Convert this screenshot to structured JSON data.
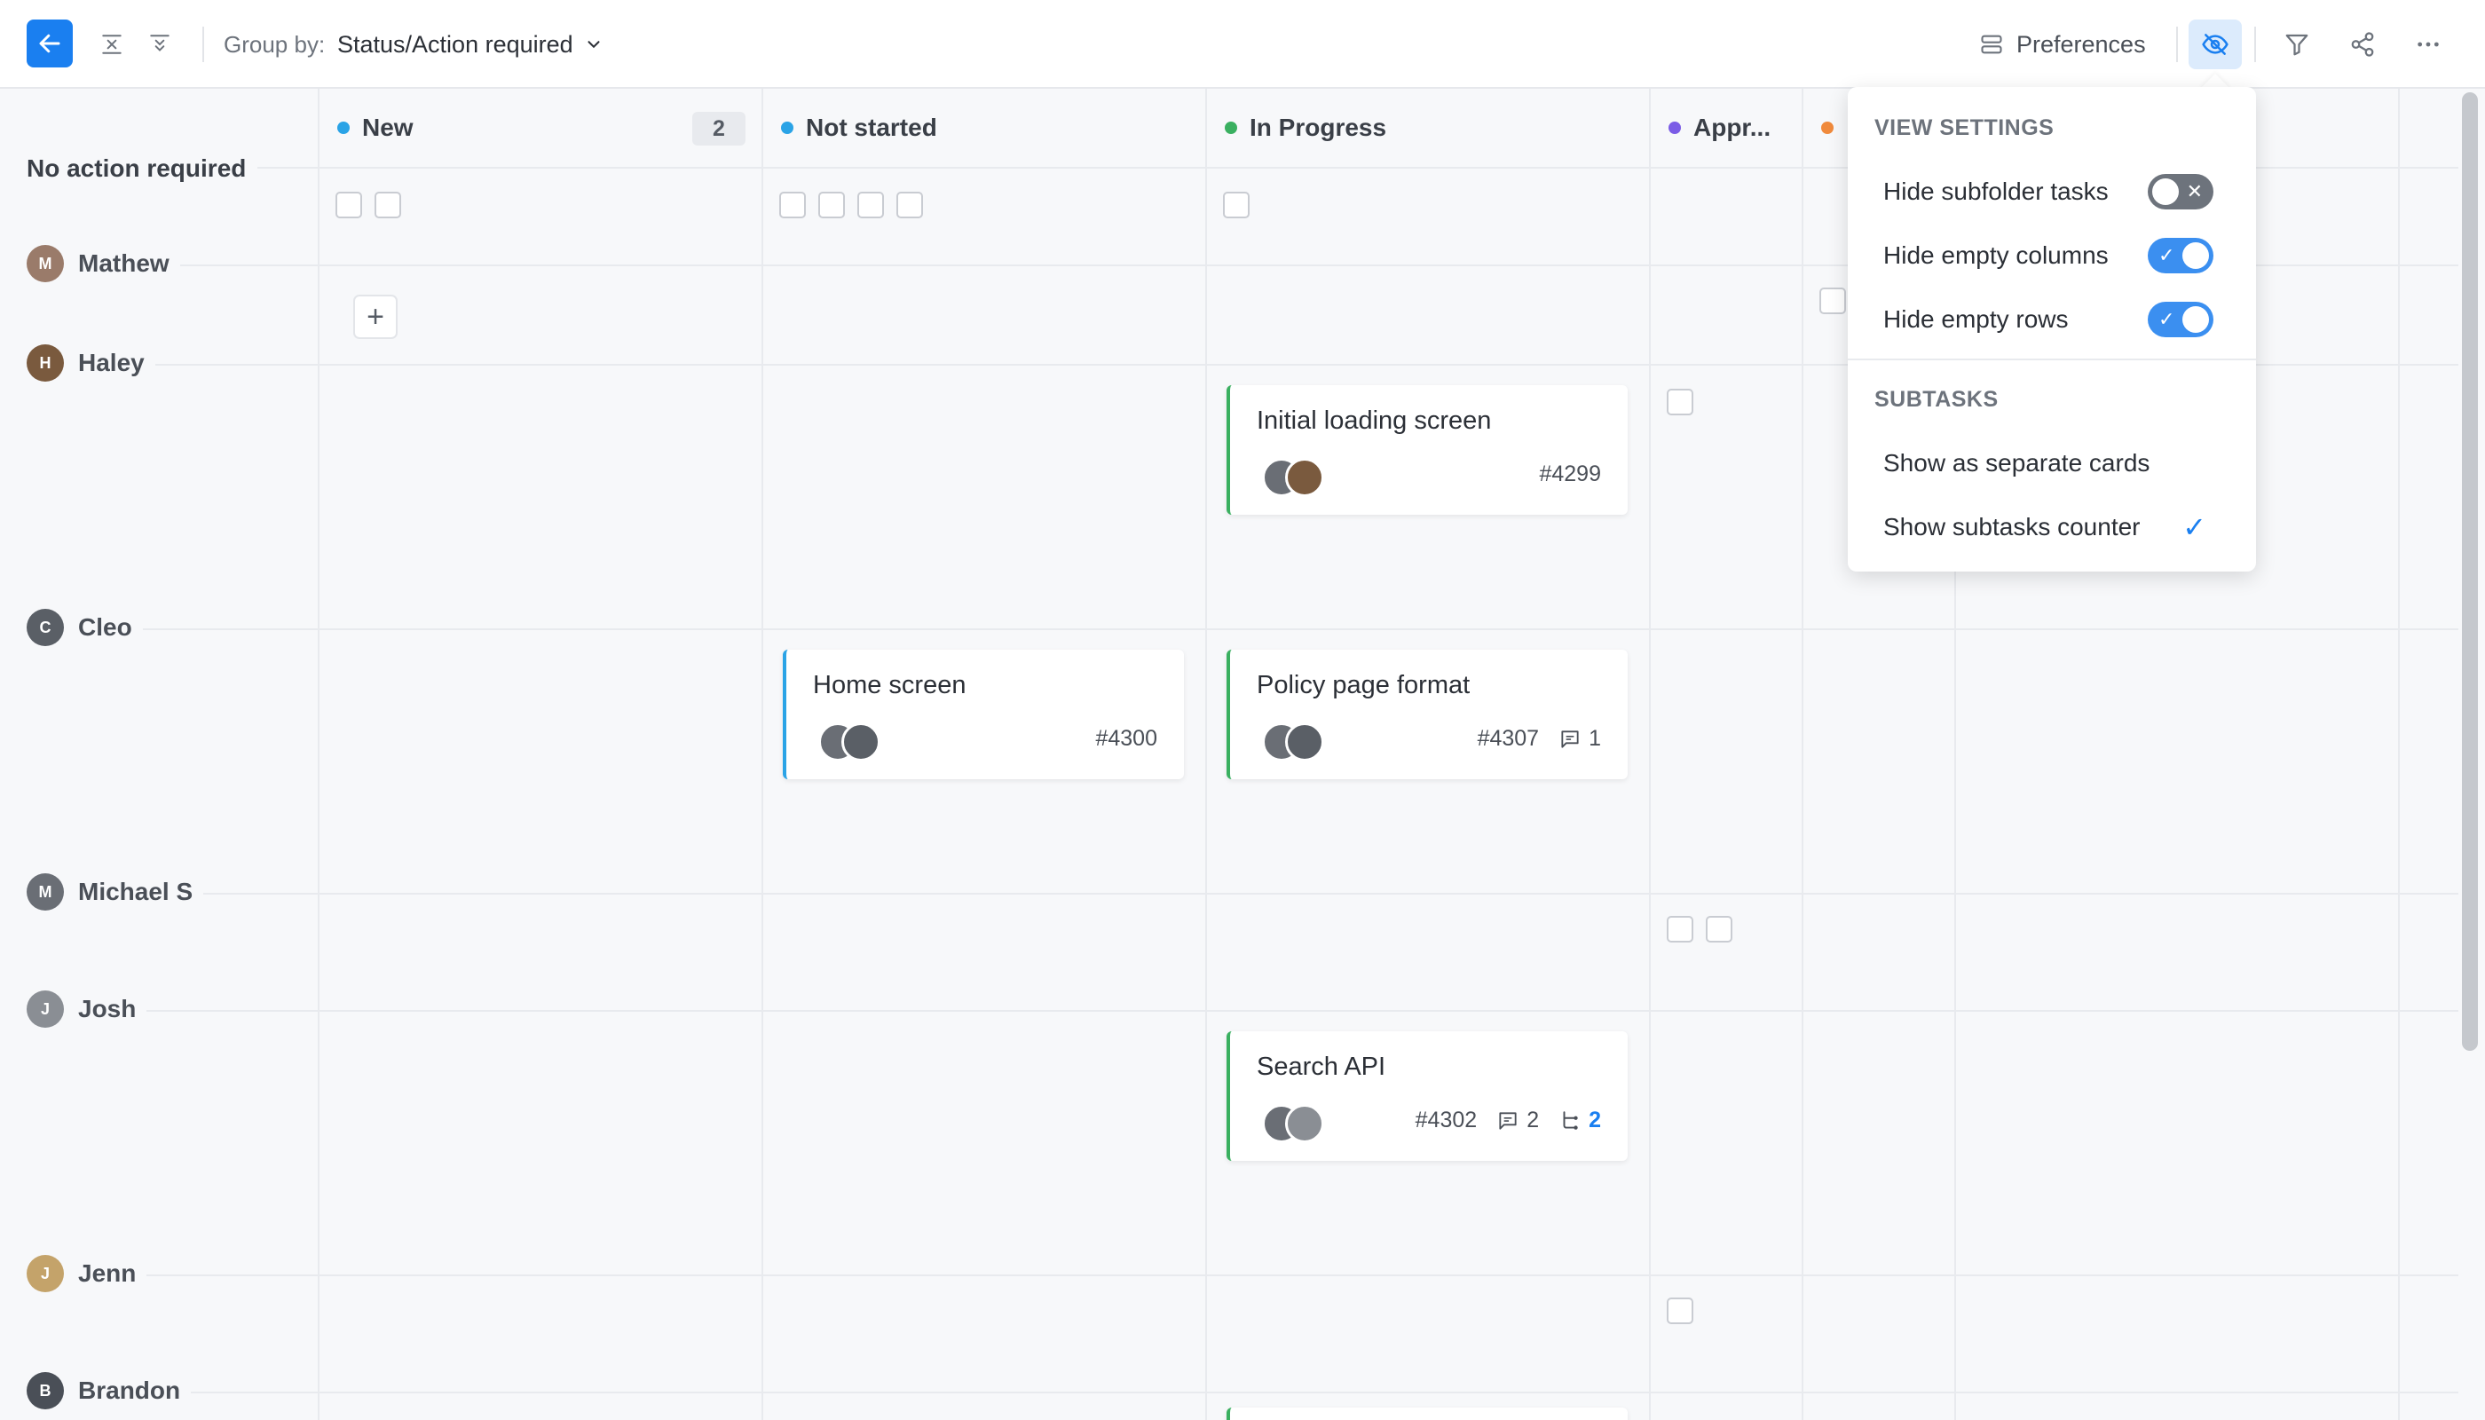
{
  "toolbar": {
    "group_by_label": "Group by:",
    "group_by_value": "Status/Action required",
    "preferences_label": "Preferences"
  },
  "columns": [
    {
      "label": "New",
      "count": "2",
      "color": "#2aa3e6"
    },
    {
      "label": "Not started",
      "color": "#2aa3e6"
    },
    {
      "label": "In Progress",
      "color": "#3ab060"
    },
    {
      "label": "Appr...",
      "color": "#7b5ce6"
    },
    {
      "label": "",
      "color": "#f08a3c"
    }
  ],
  "section_label": "No action required",
  "rows": [
    {
      "name": "Mathew",
      "avatar_color": "#9a7b6a"
    },
    {
      "name": "Haley",
      "avatar_color": "#7a5a3e"
    },
    {
      "name": "Cleo",
      "avatar_color": "#5a5f66"
    },
    {
      "name": "Michael S",
      "avatar_color": "#6a6e75"
    },
    {
      "name": "Josh",
      "avatar_color": "#8a8e94"
    },
    {
      "name": "Jenn",
      "avatar_color": "#c4a36a"
    },
    {
      "name": "Brandon",
      "avatar_color": "#4a4f57"
    }
  ],
  "cards": [
    {
      "title": "Initial loading screen",
      "id": "#4299"
    },
    {
      "title": "Home screen",
      "id": "#4300"
    },
    {
      "title": "Policy page format",
      "id": "#4307",
      "comments": "1"
    },
    {
      "title": "Search API",
      "id": "#4302",
      "comments": "2",
      "subtasks": "2"
    }
  ],
  "popover": {
    "view_settings_heading": "VIEW SETTINGS",
    "hide_subfolder_tasks": {
      "label": "Hide subfolder tasks",
      "enabled": false
    },
    "hide_empty_columns": {
      "label": "Hide empty columns",
      "enabled": true
    },
    "hide_empty_rows": {
      "label": "Hide empty rows",
      "enabled": true
    },
    "subtasks_heading": "SUBTASKS",
    "show_as_separate_cards": {
      "label": "Show as separate cards",
      "selected": false
    },
    "show_subtasks_counter": {
      "label": "Show subtasks counter",
      "selected": true
    }
  },
  "colors": {
    "accent": "#1a7ff0",
    "toggle_on": "#3b8ff0",
    "toggle_off": "#6d737c"
  }
}
